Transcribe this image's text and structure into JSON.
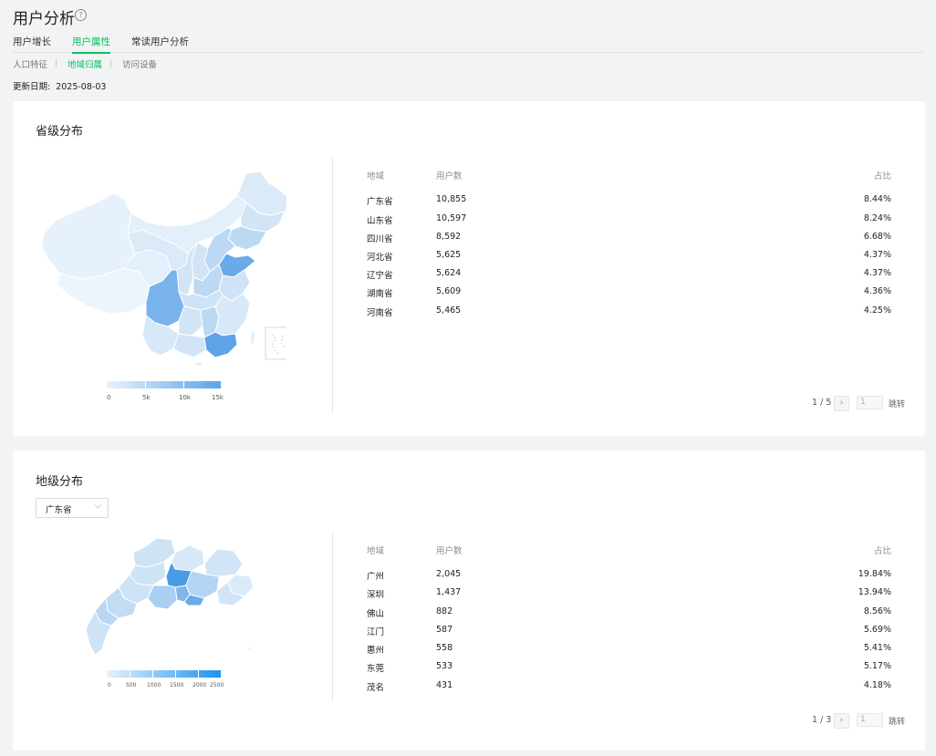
{
  "header": {
    "title": "用户分析",
    "help_icon": "?"
  },
  "tabs": [
    {
      "label": "用户增长",
      "active": false
    },
    {
      "label": "用户属性",
      "active": true
    },
    {
      "label": "常读用户分析",
      "active": false
    }
  ],
  "subtabs": [
    {
      "label": "人口特征",
      "active": false
    },
    {
      "label": "地域归属",
      "active": true
    },
    {
      "label": "访问设备",
      "active": false
    }
  ],
  "update": {
    "label": "更新日期:",
    "date": "2025-08-03"
  },
  "province_section": {
    "title": "省级分布",
    "columns": {
      "region": "地域",
      "users": "用户数",
      "ratio": "占比"
    },
    "rows": [
      {
        "region": "广东省",
        "users": "10,855",
        "ratio": "8.44%"
      },
      {
        "region": "山东省",
        "users": "10,597",
        "ratio": "8.24%"
      },
      {
        "region": "四川省",
        "users": "8,592",
        "ratio": "6.68%"
      },
      {
        "region": "河北省",
        "users": "5,625",
        "ratio": "4.37%"
      },
      {
        "region": "辽宁省",
        "users": "5,624",
        "ratio": "4.37%"
      },
      {
        "region": "湖南省",
        "users": "5,609",
        "ratio": "4.36%"
      },
      {
        "region": "河南省",
        "users": "5,465",
        "ratio": "4.25%"
      }
    ],
    "legend": [
      "0",
      "5k",
      "10k",
      "15k"
    ],
    "pager": {
      "page": "1 / 5",
      "next_icon": "›",
      "input": "1",
      "jump": "跳转"
    }
  },
  "city_section": {
    "title": "地级分布",
    "select": {
      "value": "广东省",
      "icon": "chevron-down-icon"
    },
    "columns": {
      "region": "地域",
      "users": "用户数",
      "ratio": "占比"
    },
    "rows": [
      {
        "region": "广州",
        "users": "2,045",
        "ratio": "19.84%"
      },
      {
        "region": "深圳",
        "users": "1,437",
        "ratio": "13.94%"
      },
      {
        "region": "佛山",
        "users": "882",
        "ratio": "8.56%"
      },
      {
        "region": "江门",
        "users": "587",
        "ratio": "5.69%"
      },
      {
        "region": "惠州",
        "users": "558",
        "ratio": "5.41%"
      },
      {
        "region": "东莞",
        "users": "533",
        "ratio": "5.17%"
      },
      {
        "region": "茂名",
        "users": "431",
        "ratio": "4.18%"
      }
    ],
    "legend": [
      "0",
      "500",
      "1000",
      "1500",
      "2000",
      "2500"
    ],
    "pager": {
      "page": "1 / 3",
      "next_icon": "›",
      "input": "1",
      "jump": "跳转"
    }
  },
  "colors": {
    "accent": "#07c160",
    "map_light": "#e3effa",
    "map_dark": "#4c9be6"
  }
}
